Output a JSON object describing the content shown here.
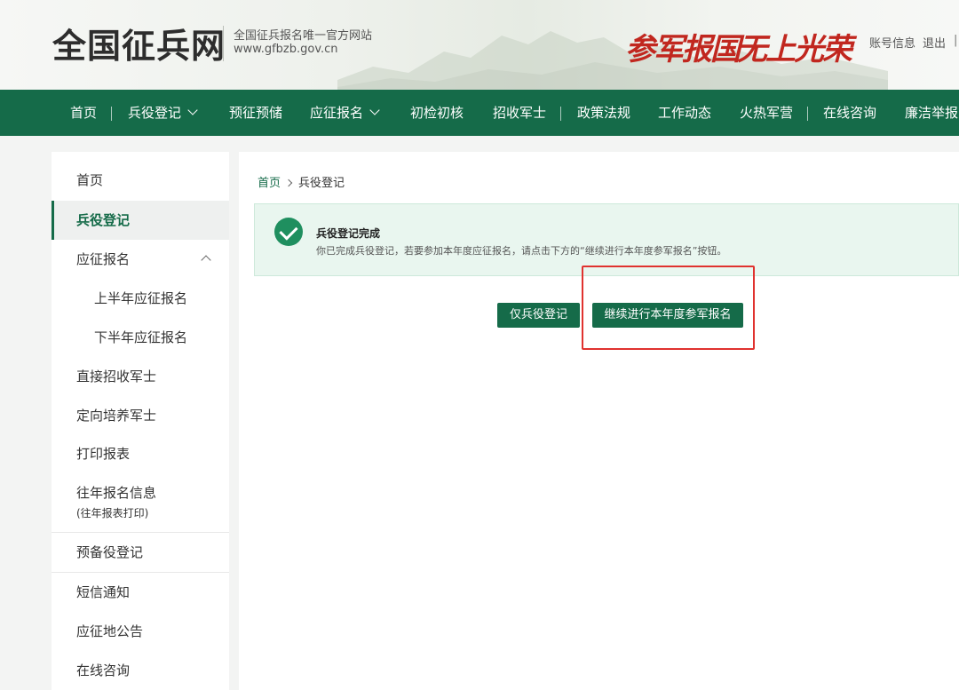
{
  "header": {
    "logo": "全国征兵网",
    "subtitle": "全国征兵报名唯一官方网站",
    "url": "www.gfbzb.gov.cn",
    "slogan_left": "参军报国",
    "slogan_right": "无上光荣",
    "account": "账号信息",
    "logout": "退出",
    "separator": "|"
  },
  "nav": {
    "items": [
      {
        "label": "首页"
      },
      {
        "label": "兵役登记"
      },
      {
        "label": "预征预储"
      },
      {
        "label": "应征报名"
      },
      {
        "label": "初检初核"
      },
      {
        "label": "招收军士"
      },
      {
        "label": "政策法规"
      },
      {
        "label": "工作动态"
      },
      {
        "label": "火热军营"
      },
      {
        "label": "在线咨询"
      },
      {
        "label": "廉洁举报"
      }
    ]
  },
  "sidebar": {
    "items": [
      {
        "label": "首页"
      },
      {
        "label": "兵役登记"
      },
      {
        "label": "应征报名"
      },
      {
        "label": "上半年应征报名"
      },
      {
        "label": "下半年应征报名"
      },
      {
        "label": "直接招收军士"
      },
      {
        "label": "定向培养军士"
      },
      {
        "label": "打印报表"
      },
      {
        "label": "往年报名信息"
      },
      {
        "label": "(往年报表打印)"
      },
      {
        "label": "预备役登记"
      },
      {
        "label": "短信通知"
      },
      {
        "label": "应征地公告"
      },
      {
        "label": "在线咨询"
      }
    ]
  },
  "breadcrumb": {
    "home": "首页",
    "current": "兵役登记"
  },
  "notice": {
    "title": "兵役登记完成",
    "text": "你已完成兵役登记，若要参加本年度应征报名，请点击下方的“继续进行本年度参军报名”按钮。"
  },
  "buttons": {
    "only_register": "仅兵役登记",
    "continue": "继续进行本年度参军报名"
  },
  "colors": {
    "brand_green": "#156b49",
    "success_green": "#1f8f5f",
    "slogan_red": "#c1271f",
    "highlight_red": "#e0322f"
  }
}
